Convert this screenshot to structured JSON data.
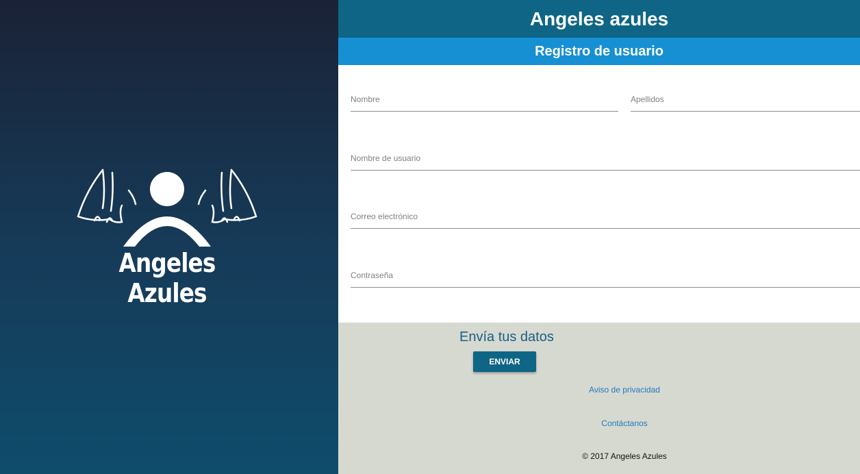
{
  "brand": {
    "logo_text": "Angeles Azules"
  },
  "header": {
    "title": "Angeles azules",
    "subtitle": "Registro de usuario"
  },
  "form": {
    "first_name_placeholder": "Nombre",
    "last_name_placeholder": "Apellidos",
    "username_placeholder": "Nombre de usuario",
    "email_placeholder": "Correo electrónico",
    "password_placeholder": "Contraseña",
    "first_name_value": "",
    "last_name_value": "",
    "username_value": "",
    "email_value": "",
    "password_value": ""
  },
  "footer": {
    "title": "Envía tus datos",
    "send_label": "ENVIAR",
    "privacy_link": "Aviso de privacidad",
    "contact_link": "Contáctanos",
    "copyright": "© 2017 Angeles Azules"
  },
  "colors": {
    "app_bar": "#0e6585",
    "sub_bar": "#1690d3",
    "footer_bg": "#d6d9d0",
    "left_gradient_top": "#1a2236",
    "left_gradient_bottom": "#0f4c6c",
    "link": "#1f78c4"
  },
  "icons": {
    "logo": "angel-driver-logo"
  }
}
